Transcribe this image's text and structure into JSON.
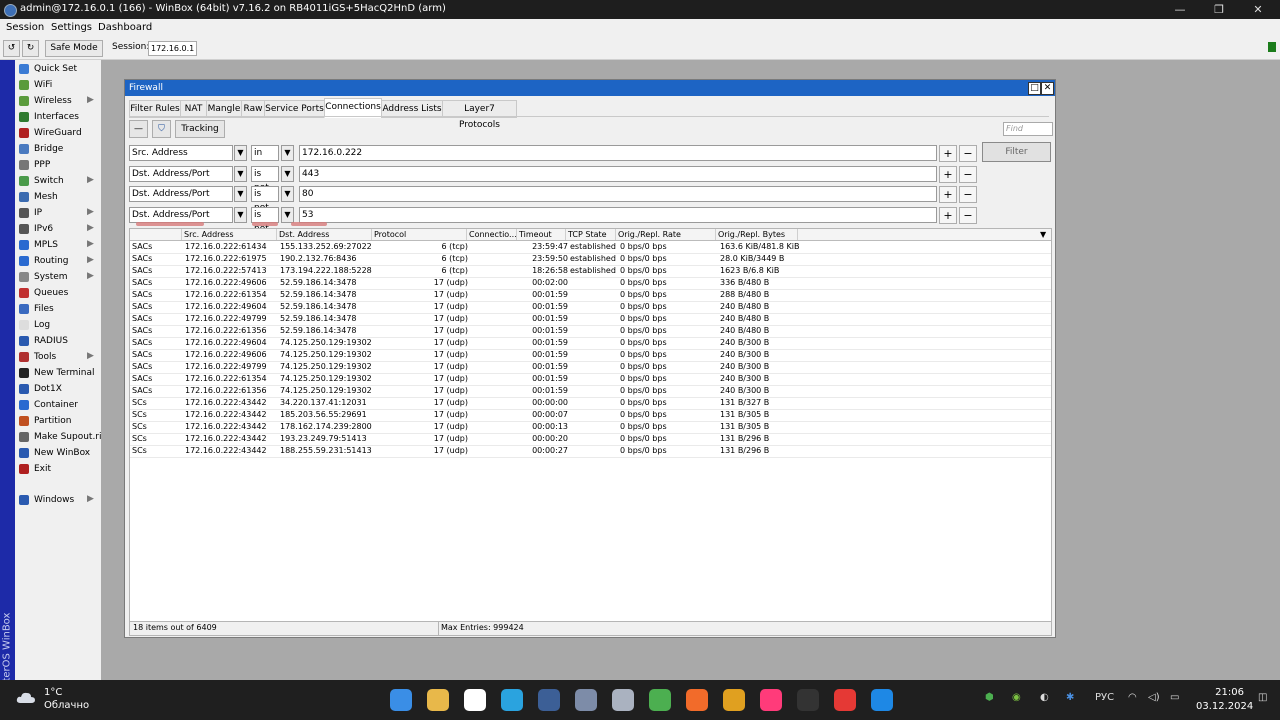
{
  "titlebar": {
    "title": "admin@172.16.0.1 (166) - WinBox (64bit) v7.16.2 on RB4011iGS+5HacQ2HnD (arm)",
    "minimize": "—",
    "restore": "❐",
    "close": "✕"
  },
  "menu": {
    "session": "Session",
    "settings": "Settings",
    "dashboard": "Dashboard"
  },
  "toolbar": {
    "undo": "↺",
    "redo": "↻",
    "safe_mode": "Safe Mode",
    "session_label": "Session:",
    "session_value": "172.16.0.1"
  },
  "brand": {
    "text": "RouterOS WinBox"
  },
  "sidebar": {
    "items": [
      {
        "label": "Quick Set",
        "icon": "quick-set-icon",
        "color": "#3b7bd4",
        "arrow": false
      },
      {
        "label": "WiFi",
        "icon": "wifi-icon",
        "color": "#5a9b3c",
        "arrow": false
      },
      {
        "label": "Wireless",
        "icon": "wireless-icon",
        "color": "#5a9b3c",
        "arrow": true
      },
      {
        "label": "Interfaces",
        "icon": "interfaces-icon",
        "color": "#2f7a2f",
        "arrow": false
      },
      {
        "label": "WireGuard",
        "icon": "wireguard-icon",
        "color": "#b02020",
        "arrow": false
      },
      {
        "label": "Bridge",
        "icon": "bridge-icon",
        "color": "#4a7ac0",
        "arrow": false
      },
      {
        "label": "PPP",
        "icon": "ppp-icon",
        "color": "#777777",
        "arrow": false
      },
      {
        "label": "Switch",
        "icon": "switch-icon",
        "color": "#4a9a4a",
        "arrow": true
      },
      {
        "label": "Mesh",
        "icon": "mesh-icon",
        "color": "#3b6bb0",
        "arrow": false
      },
      {
        "label": "IP",
        "icon": "ip-icon",
        "color": "#555555",
        "arrow": true
      },
      {
        "label": "IPv6",
        "icon": "ipv6-icon",
        "color": "#555555",
        "arrow": true
      },
      {
        "label": "MPLS",
        "icon": "mpls-icon",
        "color": "#2a6ad0",
        "arrow": true
      },
      {
        "label": "Routing",
        "icon": "routing-icon",
        "color": "#2a6ad0",
        "arrow": true
      },
      {
        "label": "System",
        "icon": "system-icon",
        "color": "#888888",
        "arrow": true
      },
      {
        "label": "Queues",
        "icon": "queues-icon",
        "color": "#c03030",
        "arrow": false
      },
      {
        "label": "Files",
        "icon": "files-icon",
        "color": "#3a6ac0",
        "arrow": false
      },
      {
        "label": "Log",
        "icon": "log-icon",
        "color": "#dddddd",
        "arrow": false
      },
      {
        "label": "RADIUS",
        "icon": "radius-icon",
        "color": "#2a5ab0",
        "arrow": false
      },
      {
        "label": "Tools",
        "icon": "tools-icon",
        "color": "#b03030",
        "arrow": true
      },
      {
        "label": "New Terminal",
        "icon": "terminal-icon",
        "color": "#222222",
        "arrow": false
      },
      {
        "label": "Dot1X",
        "icon": "dot1x-icon",
        "color": "#2a5ab0",
        "arrow": false
      },
      {
        "label": "Container",
        "icon": "container-icon",
        "color": "#2a6ad0",
        "arrow": false
      },
      {
        "label": "Partition",
        "icon": "partition-icon",
        "color": "#c05020",
        "arrow": false
      },
      {
        "label": "Make Supout.rif",
        "icon": "supout-icon",
        "color": "#666666",
        "arrow": false
      },
      {
        "label": "New WinBox",
        "icon": "winbox-icon",
        "color": "#2a5ab0",
        "arrow": false
      },
      {
        "label": "Exit",
        "icon": "exit-icon",
        "color": "#b02020",
        "arrow": false
      }
    ],
    "windows": {
      "label": "Windows",
      "icon": "windows-icon",
      "color": "#2a5ab0"
    }
  },
  "firewall": {
    "title": "Firewall",
    "tabs": [
      "Filter Rules",
      "NAT",
      "Mangle",
      "Raw",
      "Service Ports",
      "Connections",
      "Address Lists",
      "Layer7 Protocols"
    ],
    "active_tab": "Connections",
    "tracking": "Tracking",
    "find_placeholder": "Find",
    "filter_button": "Filter",
    "filters": [
      {
        "field": "Src. Address",
        "op": "in",
        "value": "172.16.0.222"
      },
      {
        "field": "Dst. Address/Port",
        "op": "is not",
        "value": "443"
      },
      {
        "field": "Dst. Address/Port",
        "op": "is not",
        "value": "80"
      },
      {
        "field": "Dst. Address/Port",
        "op": "is not",
        "value": "53"
      }
    ],
    "columns": [
      "",
      "Src. Address",
      "Dst. Address",
      "Protocol",
      "Connectio...",
      "Timeout",
      "TCP State",
      "Orig./Repl. Rate",
      "Orig./Repl. Bytes"
    ],
    "rows": [
      [
        "SACs",
        "172.16.0.222:61434",
        "155.133.252.69:27022",
        "6 (tcp)",
        "",
        "23:59:47",
        "established",
        "0 bps/0 bps",
        "163.6 KiB/481.8 KiB"
      ],
      [
        "SACs",
        "172.16.0.222:61975",
        "190.2.132.76:8436",
        "6 (tcp)",
        "",
        "23:59:50",
        "established",
        "0 bps/0 bps",
        "28.0 KiB/3449 B"
      ],
      [
        "SACs",
        "172.16.0.222:57413",
        "173.194.222.188:5228",
        "6 (tcp)",
        "",
        "18:26:58",
        "established",
        "0 bps/0 bps",
        "1623 B/6.8 KiB"
      ],
      [
        "SACs",
        "172.16.0.222:49606",
        "52.59.186.14:3478",
        "17 (udp)",
        "",
        "00:02:00",
        "",
        "0 bps/0 bps",
        "336 B/480 B"
      ],
      [
        "SACs",
        "172.16.0.222:61354",
        "52.59.186.14:3478",
        "17 (udp)",
        "",
        "00:01:59",
        "",
        "0 bps/0 bps",
        "288 B/480 B"
      ],
      [
        "SACs",
        "172.16.0.222:49604",
        "52.59.186.14:3478",
        "17 (udp)",
        "",
        "00:01:59",
        "",
        "0 bps/0 bps",
        "240 B/480 B"
      ],
      [
        "SACs",
        "172.16.0.222:49799",
        "52.59.186.14:3478",
        "17 (udp)",
        "",
        "00:01:59",
        "",
        "0 bps/0 bps",
        "240 B/480 B"
      ],
      [
        "SACs",
        "172.16.0.222:61356",
        "52.59.186.14:3478",
        "17 (udp)",
        "",
        "00:01:59",
        "",
        "0 bps/0 bps",
        "240 B/480 B"
      ],
      [
        "SACs",
        "172.16.0.222:49604",
        "74.125.250.129:19302",
        "17 (udp)",
        "",
        "00:01:59",
        "",
        "0 bps/0 bps",
        "240 B/300 B"
      ],
      [
        "SACs",
        "172.16.0.222:49606",
        "74.125.250.129:19302",
        "17 (udp)",
        "",
        "00:01:59",
        "",
        "0 bps/0 bps",
        "240 B/300 B"
      ],
      [
        "SACs",
        "172.16.0.222:49799",
        "74.125.250.129:19302",
        "17 (udp)",
        "",
        "00:01:59",
        "",
        "0 bps/0 bps",
        "240 B/300 B"
      ],
      [
        "SACs",
        "172.16.0.222:61354",
        "74.125.250.129:19302",
        "17 (udp)",
        "",
        "00:01:59",
        "",
        "0 bps/0 bps",
        "240 B/300 B"
      ],
      [
        "SACs",
        "172.16.0.222:61356",
        "74.125.250.129:19302",
        "17 (udp)",
        "",
        "00:01:59",
        "",
        "0 bps/0 bps",
        "240 B/300 B"
      ],
      [
        "SCs",
        "172.16.0.222:43442",
        "34.220.137.41:12031",
        "17 (udp)",
        "",
        "00:00:00",
        "",
        "0 bps/0 bps",
        "131 B/327 B"
      ],
      [
        "SCs",
        "172.16.0.222:43442",
        "185.203.56.55:29691",
        "17 (udp)",
        "",
        "00:00:07",
        "",
        "0 bps/0 bps",
        "131 B/305 B"
      ],
      [
        "SCs",
        "172.16.0.222:43442",
        "178.162.174.239:28009",
        "17 (udp)",
        "",
        "00:00:13",
        "",
        "0 bps/0 bps",
        "131 B/305 B"
      ],
      [
        "SCs",
        "172.16.0.222:43442",
        "193.23.249.79:51413",
        "17 (udp)",
        "",
        "00:00:20",
        "",
        "0 bps/0 bps",
        "131 B/296 B"
      ],
      [
        "SCs",
        "172.16.0.222:43442",
        "188.255.59.231:51413",
        "17 (udp)",
        "",
        "00:00:27",
        "",
        "0 bps/0 bps",
        "131 B/296 B"
      ]
    ],
    "status_left": "18 items out of 6409",
    "status_right": "Max Entries: 999424"
  },
  "taskbar": {
    "temp": "1°C",
    "weather": "Облачно",
    "lang": "РУС",
    "time": "21:06",
    "date": "03.12.2024",
    "apps": [
      {
        "icon": "start-icon",
        "color": "#3a8ee6"
      },
      {
        "icon": "explorer-icon",
        "color": "#e8b84a"
      },
      {
        "icon": "yandex-browser-icon",
        "color": "#ffffff"
      },
      {
        "icon": "telegram-icon",
        "color": "#2aa3df"
      },
      {
        "icon": "winbox-taskbar-icon",
        "color": "#3c5f96"
      },
      {
        "icon": "app-icon",
        "color": "#7d8ca8"
      },
      {
        "icon": "app-icon",
        "color": "#aab2c0"
      },
      {
        "icon": "notepad-icon",
        "color": "#4caf50"
      },
      {
        "icon": "app-icon",
        "color": "#f26b2a"
      },
      {
        "icon": "app-icon",
        "color": "#e0a020"
      },
      {
        "icon": "jetbrains-icon",
        "color": "#ff3b7a"
      },
      {
        "icon": "terminal-taskbar-icon",
        "color": "#333333"
      },
      {
        "icon": "app-icon",
        "color": "#e53935"
      },
      {
        "icon": "app-icon",
        "color": "#1e88e5"
      }
    ]
  }
}
